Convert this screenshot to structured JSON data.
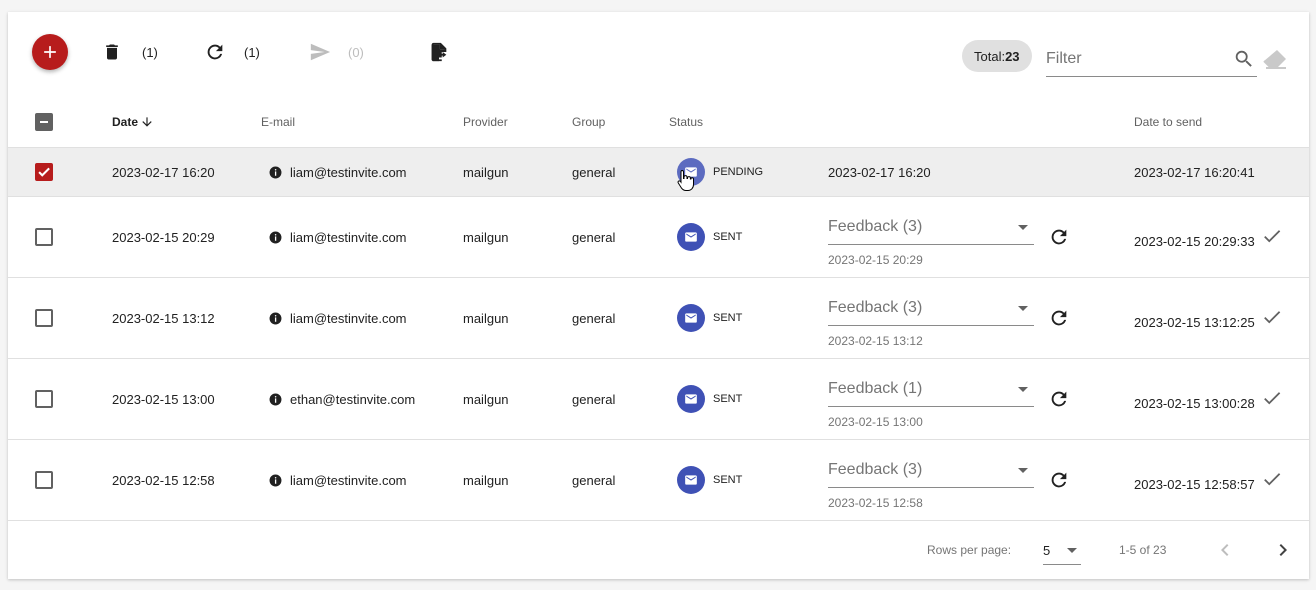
{
  "toolbar": {
    "add_icon": "plus-icon",
    "delete_count": "(1)",
    "refresh_count": "(1)",
    "send_count": "(0)",
    "export_icon": "file-export-icon",
    "total_label": "Total:",
    "total_value": "23",
    "filter_placeholder": "Filter"
  },
  "columns": {
    "date": "Date",
    "email": "E-mail",
    "provider": "Provider",
    "group": "Group",
    "status": "Status",
    "date_to_send": "Date to send"
  },
  "rows": [
    {
      "checked": true,
      "date": "2023-02-17 16:20",
      "email": "liam@testinvite.com",
      "provider": "mailgun",
      "group": "general",
      "status": "PENDING",
      "status_date": "2023-02-17 16:20",
      "date_to_send": "2023-02-17 16:20:41"
    },
    {
      "checked": false,
      "date": "2023-02-15 20:29",
      "email": "liam@testinvite.com",
      "provider": "mailgun",
      "group": "general",
      "status": "SENT",
      "feedback": "Feedback (3)",
      "feedback_date": "2023-02-15 20:29",
      "date_to_send": "2023-02-15 20:29:33"
    },
    {
      "checked": false,
      "date": "2023-02-15 13:12",
      "email": "liam@testinvite.com",
      "provider": "mailgun",
      "group": "general",
      "status": "SENT",
      "feedback": "Feedback (3)",
      "feedback_date": "2023-02-15 13:12",
      "date_to_send": "2023-02-15 13:12:25"
    },
    {
      "checked": false,
      "date": "2023-02-15 13:00",
      "email": "ethan@testinvite.com",
      "provider": "mailgun",
      "group": "general",
      "status": "SENT",
      "feedback": "Feedback (1)",
      "feedback_date": "2023-02-15 13:00",
      "date_to_send": "2023-02-15 13:00:28"
    },
    {
      "checked": false,
      "date": "2023-02-15 12:58",
      "email": "liam@testinvite.com",
      "provider": "mailgun",
      "group": "general",
      "status": "SENT",
      "feedback": "Feedback (3)",
      "feedback_date": "2023-02-15 12:58",
      "date_to_send": "2023-02-15 12:58:57"
    }
  ],
  "footer": {
    "rows_per_page_label": "Rows per page:",
    "rows_per_page_value": "5",
    "range": "1-5 of 23"
  },
  "colors": {
    "primary": "#b71c1c",
    "status_avatar": "#3f51b5"
  }
}
